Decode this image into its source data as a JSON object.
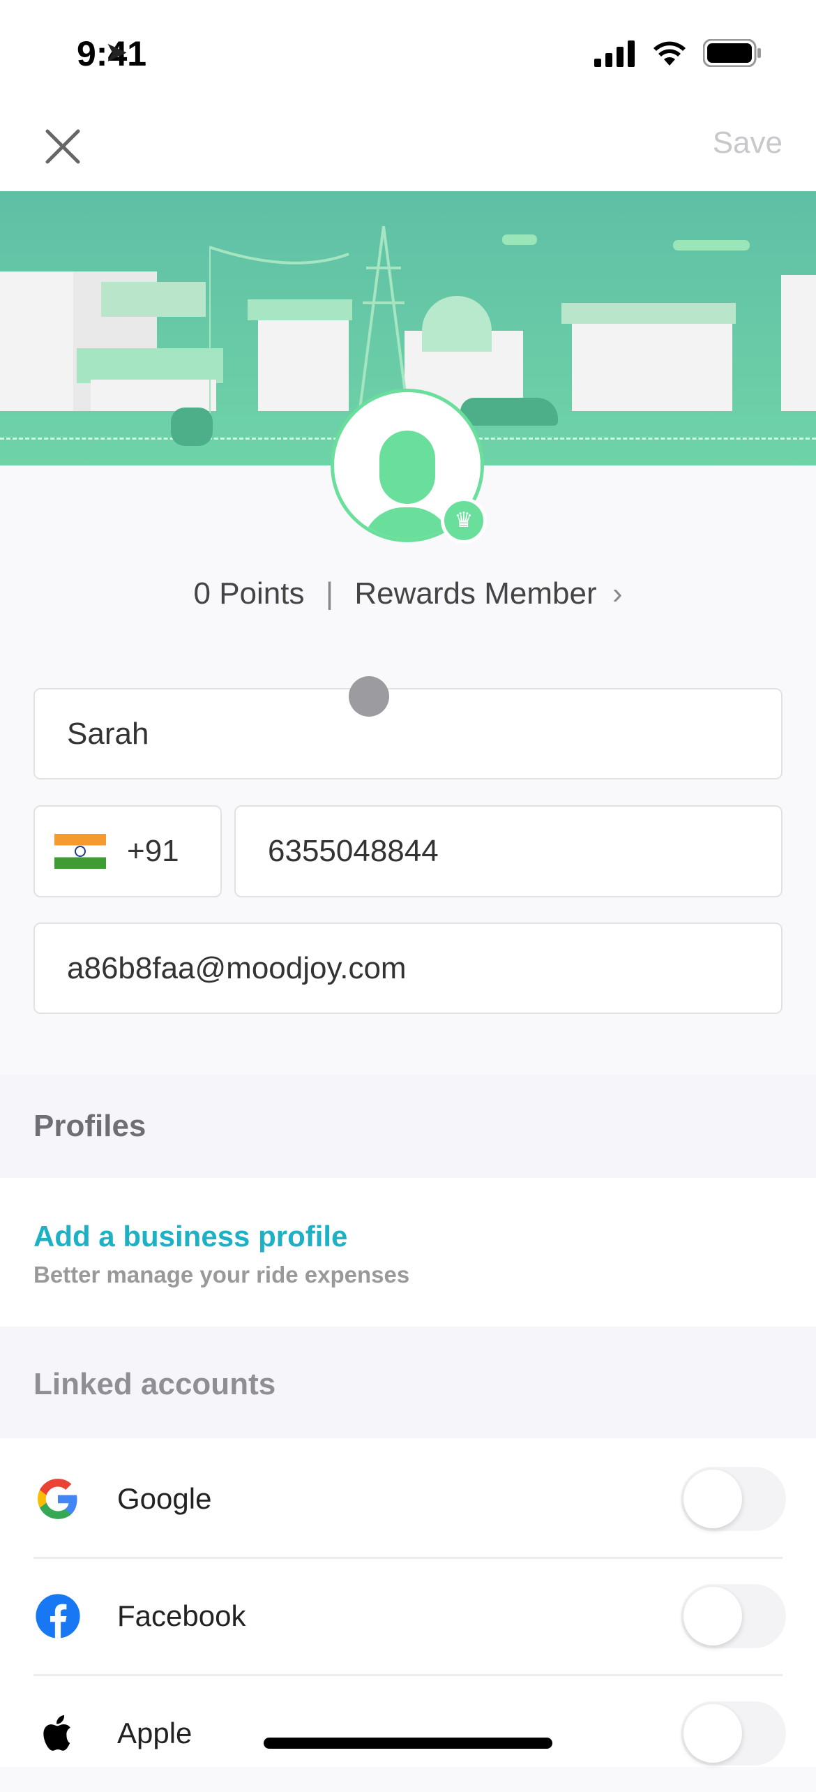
{
  "status_bar": {
    "time": "9:41"
  },
  "nav": {
    "close_icon": "close-icon",
    "save_label": "Save"
  },
  "profile": {
    "points": "0 Points",
    "separator": "|",
    "rewards": "Rewards Member",
    "chevron": "›"
  },
  "form": {
    "name": "Sarah",
    "country_code": "+91",
    "country_flag": "india-flag",
    "phone": "6355048844",
    "email": "a86b8faa@moodjoy.com"
  },
  "profiles": {
    "title": "Profiles",
    "business_link": "Add a business profile",
    "business_subtitle": "Better manage your ride expenses"
  },
  "linked": {
    "title": "Linked accounts",
    "items": [
      {
        "label": "Google",
        "icon": "google-icon",
        "enabled": false
      },
      {
        "label": "Facebook",
        "icon": "facebook-icon",
        "enabled": false
      },
      {
        "label": "Apple",
        "icon": "apple-icon",
        "enabled": false
      }
    ]
  },
  "colors": {
    "accent": "#1eb0c4",
    "green": "#6adf9c"
  }
}
